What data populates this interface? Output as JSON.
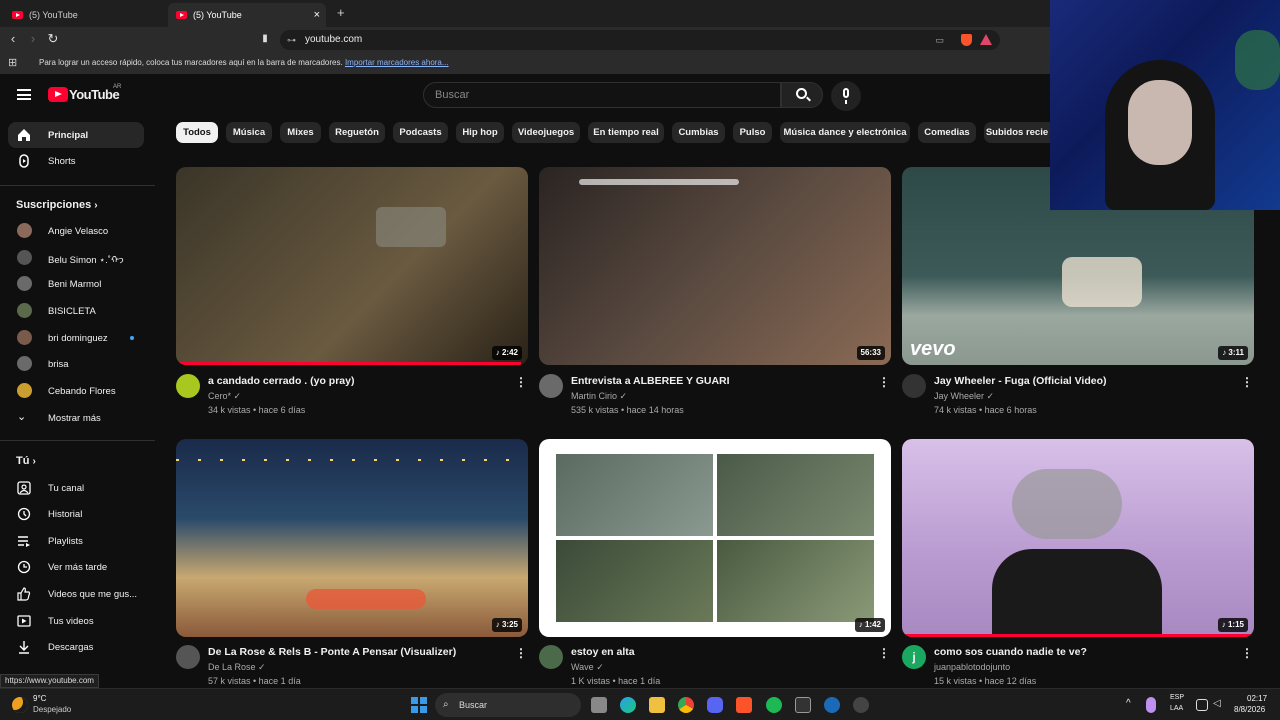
{
  "browser": {
    "tabs": [
      {
        "label": "(5) YouTube"
      },
      {
        "label": "(5) YouTube"
      }
    ],
    "new_tab": "+",
    "close": "×",
    "url": "youtube.com",
    "bookmarks_prompt": "Para lograr un acceso rápido, coloca tus marcadores aquí en la barra de marcadores.",
    "bookmarks_link": "Importar marcadores ahora..."
  },
  "header": {
    "logo_text": "YouTube",
    "region": "AR",
    "search_placeholder": "Buscar"
  },
  "sidebar": {
    "main": [
      {
        "label": "Principal",
        "icon": "home-icon"
      },
      {
        "label": "Shorts",
        "icon": "shorts-icon"
      }
    ],
    "subs_heading": "Suscripciones",
    "subs": [
      {
        "label": "Angie Velasco",
        "color": "#8a6a5a"
      },
      {
        "label": "Belu Simon ⋆.˚ᡣ𐭩",
        "color": "#555"
      },
      {
        "label": "Beni Marmol",
        "color": "#6a6a6a"
      },
      {
        "label": "BISICLETA",
        "color": "#5a6a4a"
      },
      {
        "label": "bri dominguez",
        "color": "#7a5a4a"
      },
      {
        "label": "brisa",
        "color": "#6a6a6a"
      },
      {
        "label": "Cebando Flores",
        "color": "#c9a030"
      }
    ],
    "show_more": "Mostrar más",
    "you_heading": "Tú",
    "you": [
      {
        "label": "Tu canal",
        "icon": "channel-icon"
      },
      {
        "label": "Historial",
        "icon": "history-icon"
      },
      {
        "label": "Playlists",
        "icon": "playlists-icon"
      },
      {
        "label": "Ver más tarde",
        "icon": "watch-later-icon"
      },
      {
        "label": "Videos que me gus...",
        "icon": "like-icon"
      },
      {
        "label": "Tus videos",
        "icon": "your-videos-icon"
      },
      {
        "label": "Descargas",
        "icon": "download-icon"
      }
    ]
  },
  "chips": [
    "Todos",
    "Música",
    "Mixes",
    "Reguetón",
    "Podcasts",
    "Hip hop",
    "Videojuegos",
    "En tiempo real",
    "Cumbias",
    "Pulso",
    "Música dance y electrónica",
    "Comedias",
    "Subidos recie"
  ],
  "videos": [
    {
      "title": "a candado cerrado .        (yo    pray)",
      "channel": "Cero*",
      "meta": "34 k vistas • hace 6 días",
      "duration": "2:42",
      "colors": [
        "#3a3528",
        "#6a5a40"
      ],
      "avatar": "#a8c820"
    },
    {
      "title": "Entrevista a ALBEREE Y GUARI",
      "channel": "Martin Cirio",
      "meta": "535 k vistas • hace 14 horas",
      "duration": "56:33",
      "colors": [
        "#2a2422",
        "#8a6a55"
      ],
      "avatar": "#6a6a6a"
    },
    {
      "title": "Jay Wheeler - Fuga (Official Video)",
      "channel": "Jay Wheeler",
      "meta": "74 k vistas • hace 6 horas",
      "duration": "3:11",
      "colors": [
        "#3d5a58",
        "#9aa8a0"
      ],
      "avatar": "#333"
    },
    {
      "title": "De La Rose & Rels B - Ponte A Pensar (Visualizer)",
      "channel": "De La Rose",
      "meta": "57 k vistas • hace 1 día",
      "duration": "3:25",
      "colors": [
        "#1a2a4a",
        "#8a5a3a"
      ],
      "avatar": "#555"
    },
    {
      "title": "estoy en alta",
      "channel": "Wave",
      "meta": "1 K vistas • hace 1 día",
      "duration": "1:42",
      "colors": [
        "#4a5a50",
        "#8a9a88"
      ],
      "avatar": "#4a6a4a"
    },
    {
      "title": "como sos cuando nadie te ve?",
      "channel": "juanpablotodojunto",
      "meta": "15 k vistas • hace 12 días",
      "duration": "1:15",
      "colors": [
        "#b89ad0",
        "#2a2a2a"
      ],
      "avatar": "#1aa860"
    }
  ],
  "vevo": "vevo",
  "status_url": "https://www.youtube.com",
  "taskbar": {
    "weather_temp": "9°C",
    "weather_desc": "Despejado",
    "search": "Buscar",
    "lang1": "ESP",
    "lang2": "LAA",
    "time": "02:17",
    "date": "8/8/2026"
  }
}
